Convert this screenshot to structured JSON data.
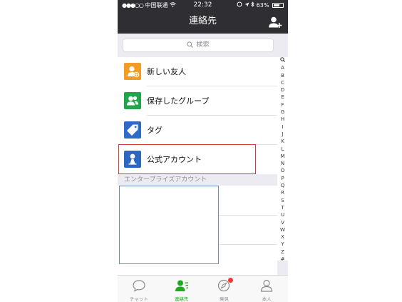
{
  "status_bar": {
    "carrier": "中国联通",
    "time": "22:32",
    "battery": "63%"
  },
  "nav": {
    "title": "連絡先"
  },
  "search": {
    "placeholder": "検索"
  },
  "menu_items": [
    {
      "label": "新しい友人",
      "icon": "add-friend-icon",
      "color": "#f29b26"
    },
    {
      "label": "保存したグループ",
      "icon": "group-icon",
      "color": "#21a44a"
    },
    {
      "label": "タグ",
      "icon": "tag-icon",
      "color": "#2e6bc6"
    },
    {
      "label": "公式アカウント",
      "icon": "official-account-icon",
      "color": "#2b67c0"
    }
  ],
  "section_header": "エンタープライズアカウント",
  "index_letters": [
    "A",
    "B",
    "C",
    "D",
    "E",
    "F",
    "G",
    "H",
    "I",
    "J",
    "K",
    "L",
    "M",
    "N",
    "O",
    "P",
    "Q",
    "R",
    "S",
    "T",
    "U",
    "V",
    "W",
    "X",
    "Y",
    "Z",
    "#"
  ],
  "tabs": [
    {
      "label": "チャット",
      "icon": "chat-bubble-icon",
      "active": false
    },
    {
      "label": "連絡先",
      "icon": "contacts-icon",
      "active": true
    },
    {
      "label": "発見",
      "icon": "compass-icon",
      "active": false
    },
    {
      "label": "本人",
      "icon": "person-icon",
      "active": false
    }
  ],
  "colors": {
    "nav_bg": "#2f2f33",
    "accent_green": "#1aad19",
    "highlight_red": "#d9393d"
  }
}
